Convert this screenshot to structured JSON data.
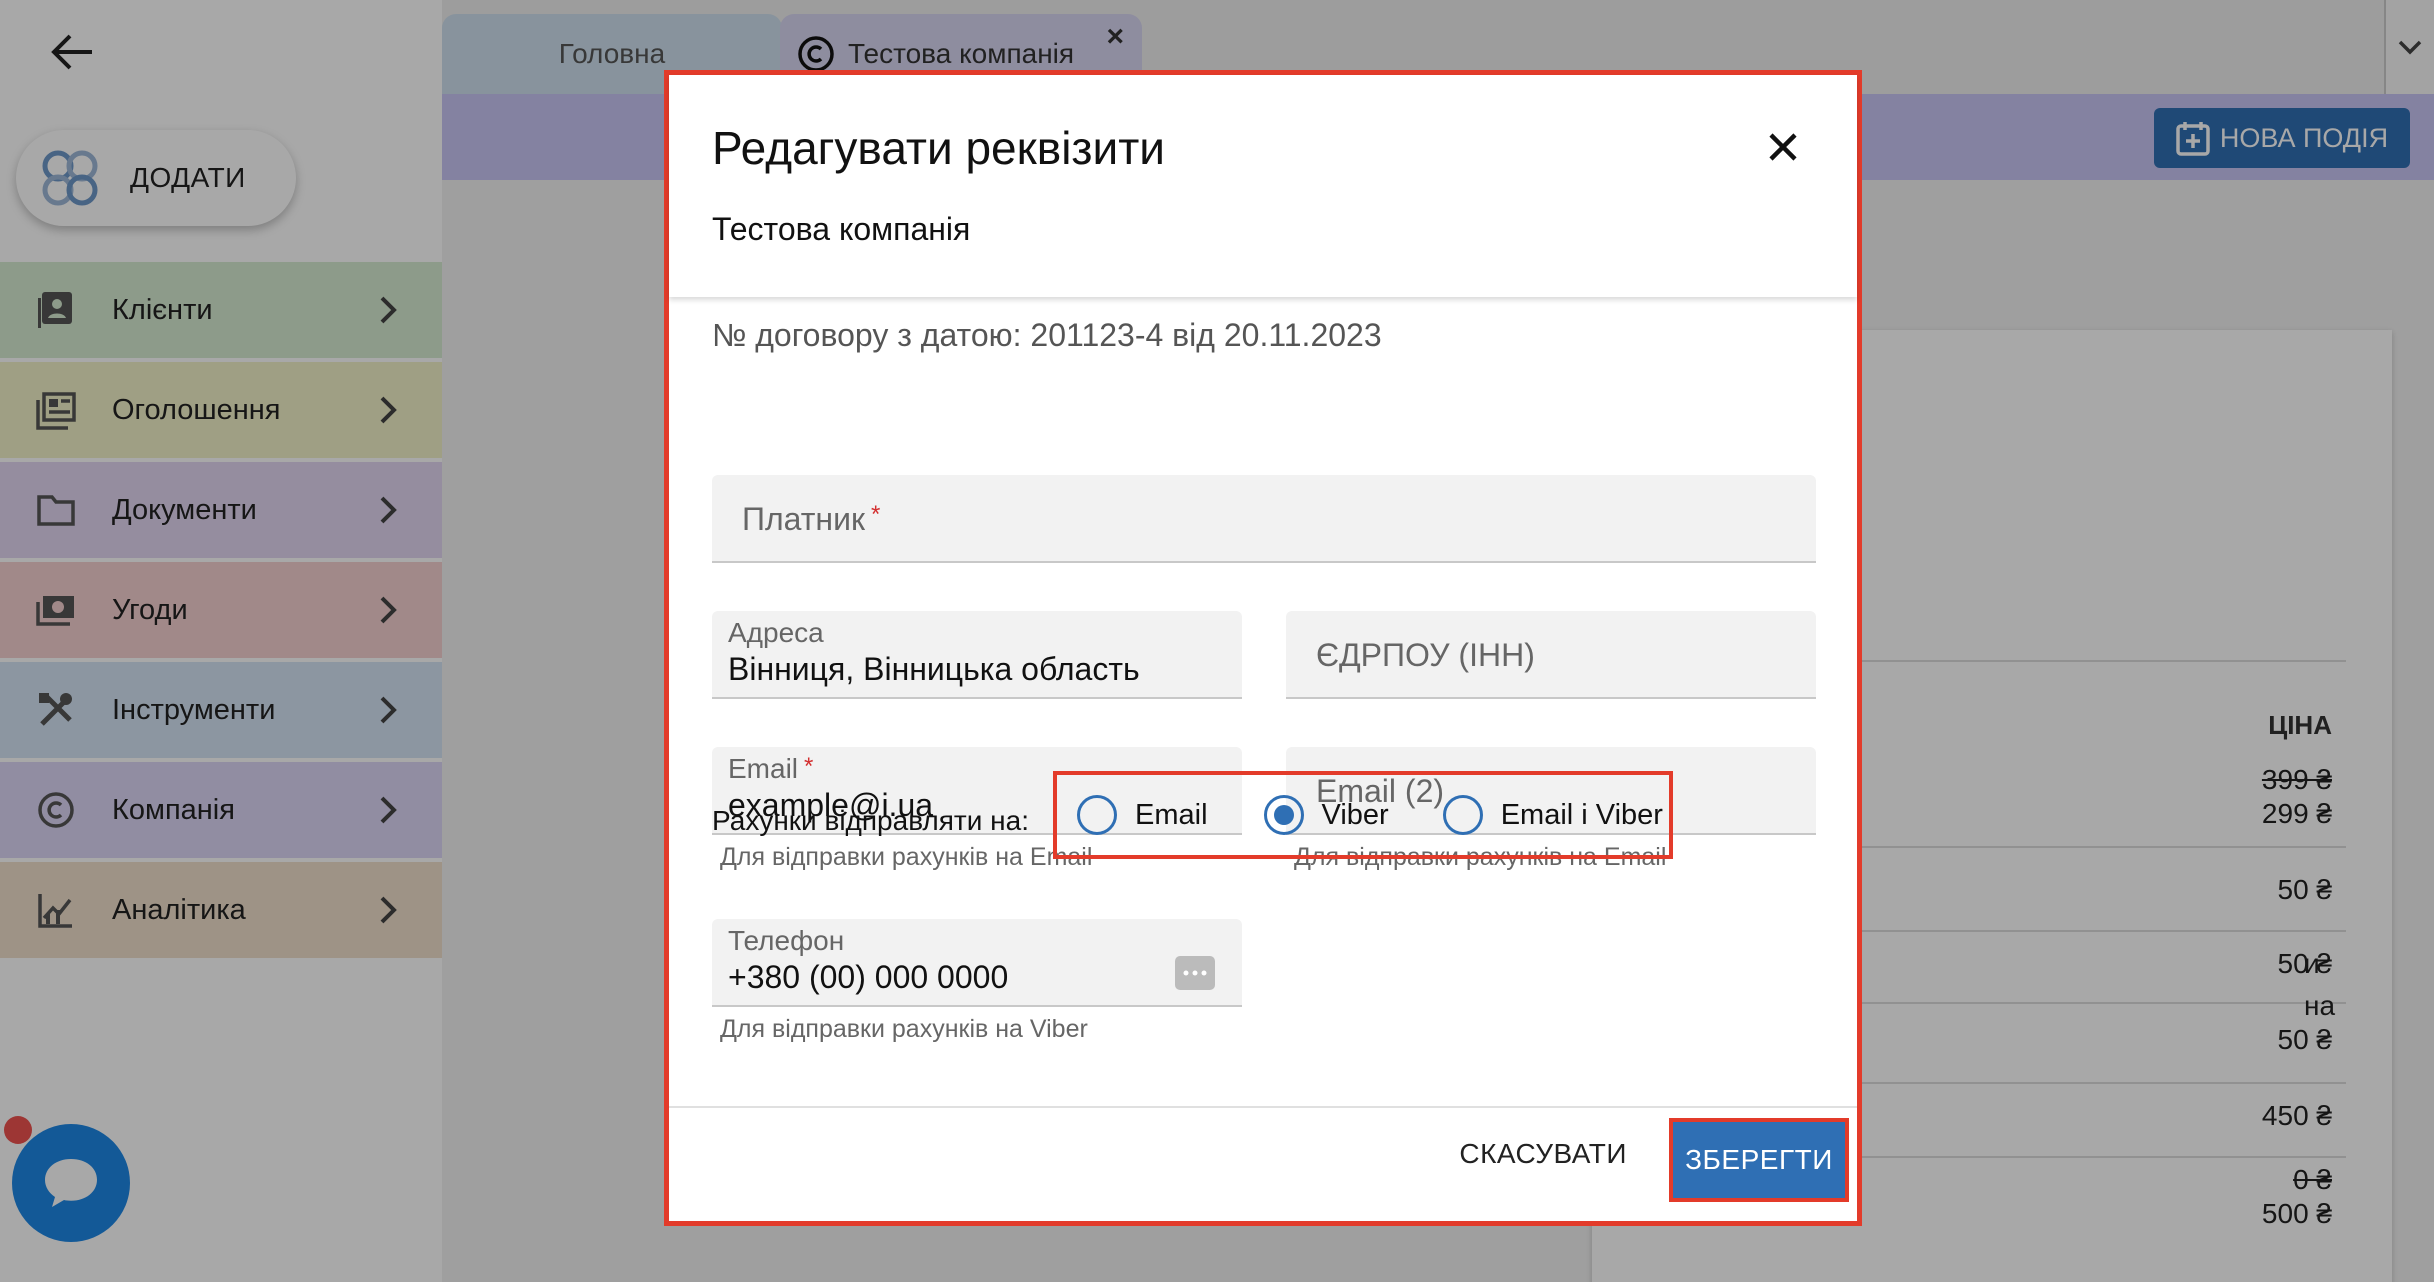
{
  "sidebar": {
    "add_label": "ДОДАТИ",
    "items": [
      {
        "label": "Клієнти",
        "color": "#d6ecd2",
        "icon": "contacts-icon"
      },
      {
        "label": "Оголошення",
        "color": "#f2f2c8",
        "icon": "listing-icon"
      },
      {
        "label": "Документи",
        "color": "#e2d6f2",
        "icon": "folder-icon"
      },
      {
        "label": "Угоди",
        "color": "#f5d1d1",
        "icon": "money-icon"
      },
      {
        "label": "Інструменти",
        "color": "#d5e4f4",
        "icon": "tools-icon"
      },
      {
        "label": "Компанія",
        "color": "#dcd6f6",
        "icon": "copyright-icon"
      },
      {
        "label": "Аналітика",
        "color": "#f0e0cc",
        "icon": "analytics-icon"
      }
    ]
  },
  "tabs": {
    "home": "Головна",
    "company": "Тестова компанія"
  },
  "toolbar": {
    "new_event": "НОВА ПОДІЯ"
  },
  "background_card": {
    "price_header": "ЦІНА",
    "rows": [
      {
        "old": "399 ₴",
        "new": "299 ₴"
      },
      {
        "new": "50 ₴"
      },
      {
        "new": "50 ₴"
      },
      {
        "new": "50 ₴"
      },
      {
        "new": "450 ₴"
      },
      {
        "old": "0 ₴",
        "new": "500 ₴"
      }
    ],
    "fragment_a": "и",
    "fragment_b": "на"
  },
  "dialog": {
    "title": "Редагувати реквізити",
    "subtitle": "Тестова компанія",
    "contract": "№ договору з датою: 201123-4 від 20.11.2023",
    "payer": {
      "label": "Платник",
      "required": "*",
      "value": ""
    },
    "address": {
      "label": "Адреса",
      "value": "Вінниця, Вінницька область"
    },
    "edrpou": {
      "label": "ЄДРПОУ (ІНН)",
      "value": ""
    },
    "email": {
      "label": "Email",
      "required": "*",
      "value": "example@i.ua",
      "helper": "Для відправки рахунків на Email"
    },
    "email2": {
      "label": "Email (2)",
      "value": "",
      "helper": "Для відправки рахунків на Email"
    },
    "phone": {
      "label": "Телефон",
      "value": "+380 (00) 000 0000",
      "helper": "Для відправки рахунків на Viber"
    },
    "send_label": "Рахунки відправляти на:",
    "send_options": [
      {
        "label": "Email",
        "selected": false
      },
      {
        "label": "Viber",
        "selected": true
      },
      {
        "label": "Email і Viber",
        "selected": false
      }
    ],
    "cancel": "СКАСУВАТИ",
    "save": "ЗБЕРЕГТИ"
  }
}
